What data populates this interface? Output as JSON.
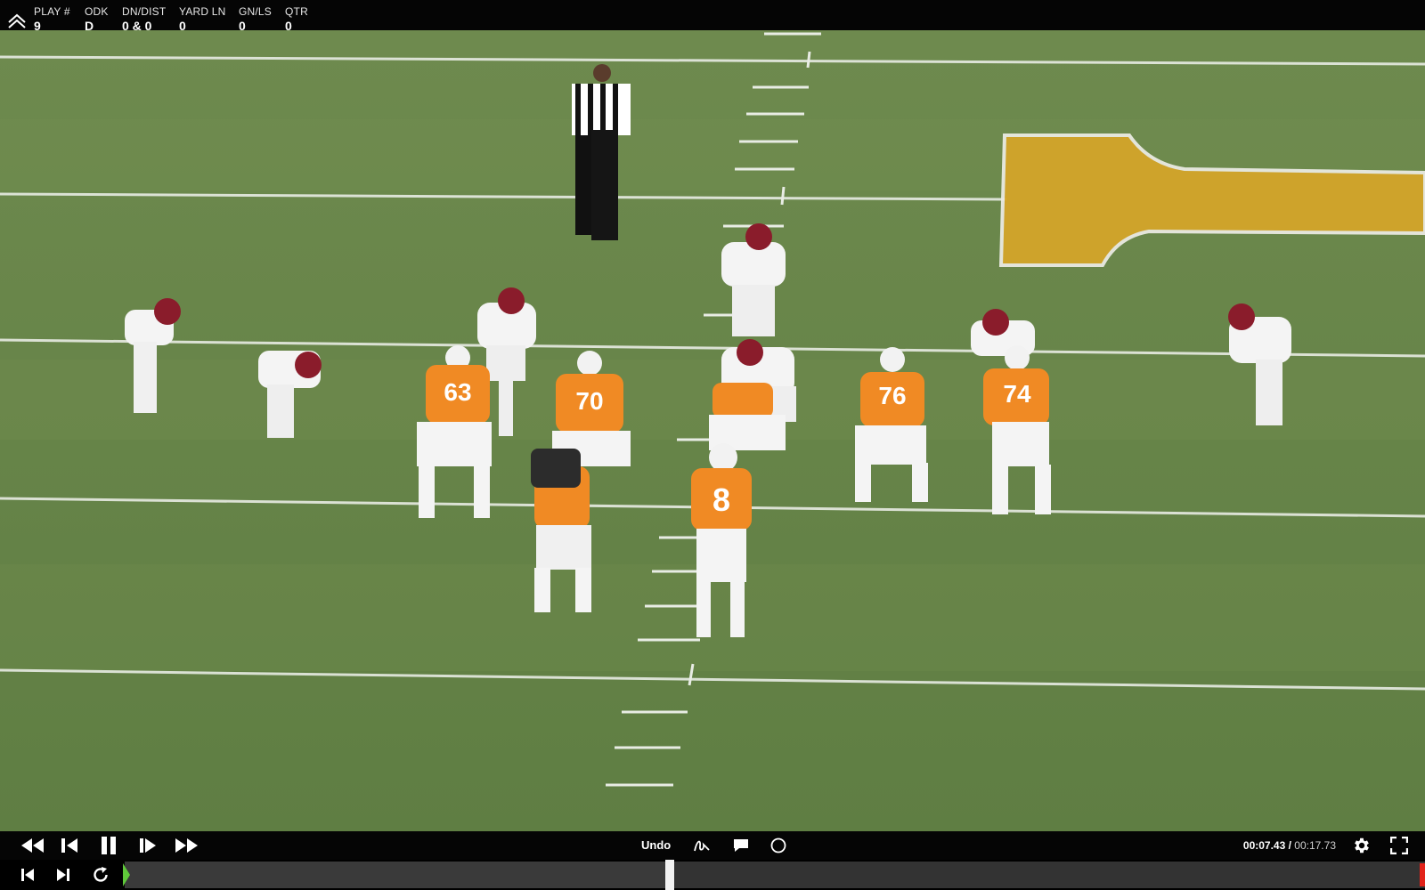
{
  "header": {
    "fields": [
      {
        "label": "PLAY #",
        "value": "9"
      },
      {
        "label": "ODK",
        "value": "D"
      },
      {
        "label": "DN/DIST",
        "value": "0 & 0"
      },
      {
        "label": "YARD LN",
        "value": "0"
      },
      {
        "label": "GN/LS",
        "value": "0"
      },
      {
        "label": "QTR",
        "value": "0"
      }
    ]
  },
  "video": {
    "jerseys": {
      "p1": "63",
      "p2": "70",
      "p3": "76",
      "p4": "74",
      "p5": "8"
    },
    "colors": {
      "home": "#f08a24",
      "away_helmet": "#8a1c2b",
      "field": "#6b8a4c",
      "logo": "#d8a528"
    }
  },
  "controls": {
    "undo_label": "Undo",
    "current_time": "00:07.43",
    "separator": " / ",
    "total_time": "00:17.73",
    "icons": [
      "rewind-icon",
      "step-back-icon",
      "pause-icon",
      "step-forward-icon",
      "fast-forward-icon",
      "draw-icon",
      "comment-icon",
      "circle-icon",
      "gear-icon",
      "fullscreen-icon"
    ]
  },
  "timeline": {
    "progress": 0.419,
    "icons": [
      "skip-start-icon",
      "skip-end-icon",
      "replay-icon"
    ]
  }
}
